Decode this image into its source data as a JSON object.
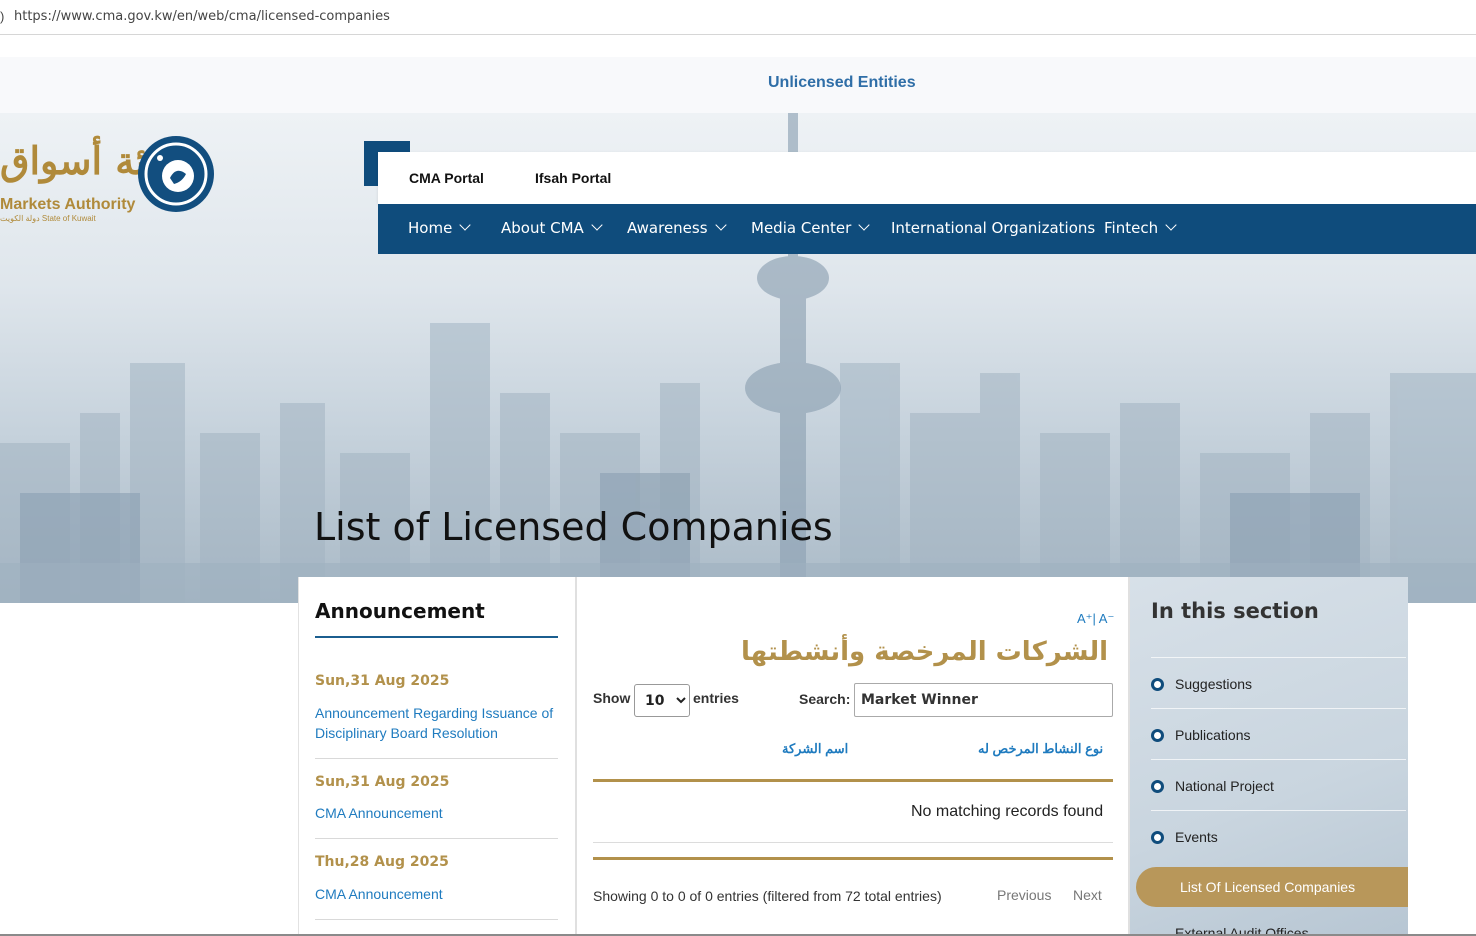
{
  "browser": {
    "url": "https://www.cma.gov.kw/en/web/cma/licensed-companies"
  },
  "top_link": "Unlicensed Entities",
  "logo": {
    "ar": "هيئة أسواق",
    "en": "Markets Authority",
    "sub": "دولة الكويت State of Kuwait"
  },
  "portals": [
    "CMA Portal",
    "Ifsah Portal"
  ],
  "nav": [
    "Home",
    "About CMA",
    "Awareness",
    "Media Center",
    "International Organizations",
    "Fintech"
  ],
  "page_title": "List of Licensed Companies",
  "announcement": {
    "heading": "Announcement",
    "items": [
      {
        "date": "Sun,31 Aug 2025",
        "title": "Announcement Regarding Issuance of Disciplinary Board Resolution"
      },
      {
        "date": "Sun,31 Aug 2025",
        "title": "CMA Announcement"
      },
      {
        "date": "Thu,28 Aug 2025",
        "title": "CMA Announcement"
      }
    ]
  },
  "main": {
    "font_size_control": "A⁺| A⁻",
    "arabic_heading": "الشركات المرخصة وأنشطتها",
    "show_label": "Show",
    "show_value": "10",
    "entries_label": "entries",
    "search_label": "Search:",
    "search_value": "Market Winner",
    "columns": [
      "نوع النشاط المرخص له",
      "اسم الشركة"
    ],
    "empty_message": "No matching records found",
    "info": "Showing 0 to 0 of 0 entries (filtered from 72 total entries)",
    "prev": "Previous",
    "next": "Next"
  },
  "section": {
    "heading": "In this section",
    "items": [
      "Suggestions",
      "Publications",
      "National Project",
      "Events"
    ],
    "active": "List Of Licensed Companies",
    "cut_item": "External Audit Offices"
  },
  "colors": {
    "navy": "#0f4c7c",
    "gold": "#b2914b",
    "link": "#1f7bbf"
  }
}
